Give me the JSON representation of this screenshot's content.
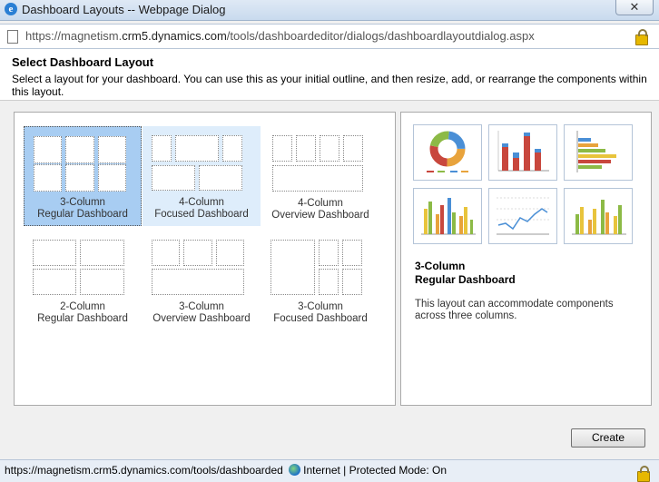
{
  "window": {
    "title": "Dashboard Layouts -- Webpage Dialog",
    "close_glyph": "✕"
  },
  "address": {
    "url_prefix": "https://magnetism.",
    "url_domain": "crm5.dynamics.com",
    "url_path": "/tools/dashboardeditor/dialogs/dashboardlayoutdialog.aspx"
  },
  "header": {
    "title": "Select Dashboard Layout",
    "description": "Select a layout for your dashboard. You can use this as your initial outline, and then resize, add, or rearrange the components within this layout."
  },
  "layouts": [
    {
      "line1": "3-Column",
      "line2": "Regular Dashboard",
      "state": "selected"
    },
    {
      "line1": "4-Column",
      "line2": "Focused Dashboard",
      "state": "hover"
    },
    {
      "line1": "4-Column",
      "line2": "Overview Dashboard",
      "state": "normal"
    },
    {
      "line1": "2-Column",
      "line2": "Regular Dashboard",
      "state": "normal"
    },
    {
      "line1": "3-Column",
      "line2": "Overview Dashboard",
      "state": "normal"
    },
    {
      "line1": "3-Column",
      "line2": "Focused Dashboard",
      "state": "normal"
    }
  ],
  "preview": {
    "thumbnails": [
      "donut-chart",
      "stacked-column-chart",
      "bar-chart",
      "column-chart",
      "line-chart",
      "column-chart"
    ],
    "title_line1": "3-Column",
    "title_line2": "Regular Dashboard",
    "description": "This layout can accommodate components across three columns."
  },
  "footer": {
    "create_label": "Create"
  },
  "statusbar": {
    "url": "https://magnetism.crm5.dynamics.com/tools/dashboarded",
    "zone": "Internet | Protected Mode: On"
  },
  "colors": {
    "selected_tile": "#a8cdf2",
    "hover_tile": "#deedfb",
    "panel_border": "#a9a9a9"
  }
}
